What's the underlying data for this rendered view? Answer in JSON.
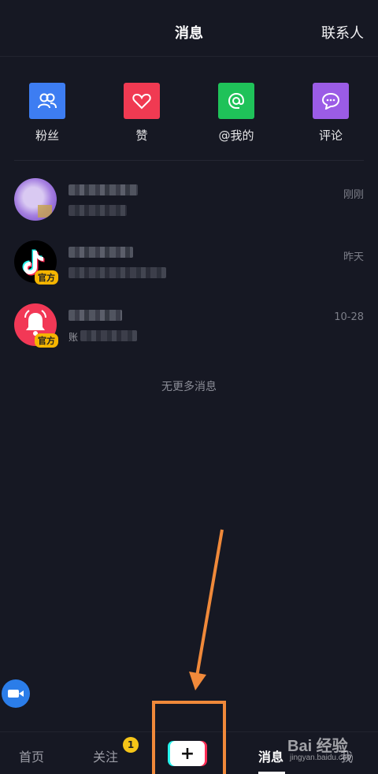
{
  "header": {
    "title": "消息",
    "contacts": "联系人"
  },
  "quick": [
    {
      "label": "粉丝",
      "icon": "fans-icon",
      "color": "#3d7df2"
    },
    {
      "label": "赞",
      "icon": "heart-icon",
      "color": "#f03a52"
    },
    {
      "label": "@我的",
      "icon": "at-icon",
      "color": "#1fc259"
    },
    {
      "label": "评论",
      "icon": "comment-icon",
      "color": "#9b5ce6"
    }
  ],
  "messages": [
    {
      "time": "刚刚",
      "badge": "",
      "prefix": ""
    },
    {
      "time": "昨天",
      "badge": "官方",
      "prefix": ""
    },
    {
      "time": "10-28",
      "badge": "官方",
      "prefix": "账"
    }
  ],
  "no_more": "无更多消息",
  "tabbar": {
    "home": "首页",
    "follow": "关注",
    "follow_badge": "1",
    "add": "+",
    "messages": "消息",
    "me": "我"
  },
  "watermark": {
    "brand": "Bai 经验",
    "url": "jingyan.baidu.com"
  },
  "colors": {
    "background": "#161823",
    "annotation": "#f0893a"
  }
}
